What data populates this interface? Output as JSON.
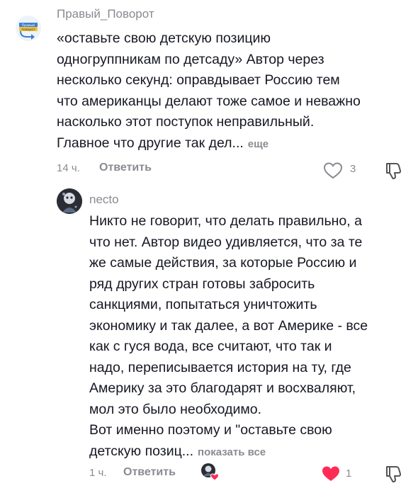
{
  "comment1": {
    "username": "Правый_Поворот",
    "avatar_logo_text": [
      "Правый",
      "поворот"
    ],
    "lines": [
      "«оставьте свою детскую позицию",
      "одногруппникам по детсаду» Автор через",
      "несколько секунд: оправдывает Россию тем",
      "что американцы делают тоже самое и неважно",
      "насколько этот поступок неправильный.",
      "Главное что другие так дел..."
    ],
    "more_label": "еще",
    "time": "14 ч.",
    "reply_label": "Ответить",
    "like_count": "3",
    "icons": {
      "like": "heart-outline-icon",
      "dislike": "thumb-down-icon"
    }
  },
  "comment2": {
    "username": "necto",
    "lines": [
      "Никто не говорит, что делать правильно, а",
      "что нет. Автор видео удивляется, что за те",
      "же самые действия, за которые Россию и",
      "ряд других стран готовы забросить",
      "санкциями, попытаться уничтожить",
      "экономику и так далее, а вот Америке - все",
      "как с гуся вода, все считают, что так и",
      "надо, переписывается история на ту, где",
      "Америку за это благодарят и восхваляют,",
      "мол это было необходимо.",
      "Вот именно поэтому и \"оставьте свою",
      "детскую позиц..."
    ],
    "more_label": "показать все",
    "time": "1 ч.",
    "reply_label": "Ответить",
    "like_count": "1",
    "icons": {
      "like": "heart-filled-icon",
      "dislike": "thumb-down-icon",
      "liked_by": "creator-liked-avatar-icon"
    },
    "like_color": "#fe2c55"
  }
}
